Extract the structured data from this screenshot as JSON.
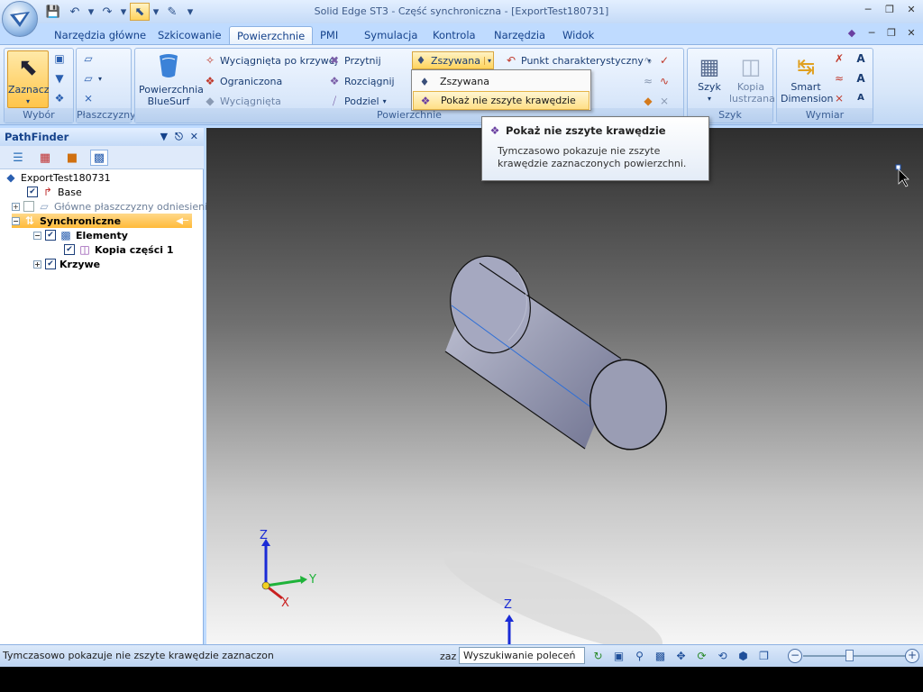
{
  "window": {
    "title": "Solid Edge ST3 - Część synchroniczna - [ExportTest180731]"
  },
  "quick_access": {
    "icons": [
      "save-icon",
      "undo-icon",
      "redo-icon",
      "select-arrow-icon",
      "run-icon"
    ]
  },
  "tabs": [
    {
      "label": "Narzędzia główne",
      "active": false
    },
    {
      "label": "Szkicowanie",
      "active": false
    },
    {
      "label": "Powierzchnie",
      "active": true
    },
    {
      "label": "PMI",
      "active": false
    },
    {
      "label": "Symulacja",
      "active": false
    },
    {
      "label": "Kontrola",
      "active": false
    },
    {
      "label": "Narzędzia",
      "active": false
    },
    {
      "label": "Widok",
      "active": false
    }
  ],
  "ribbon": {
    "wybor": {
      "label": "Wybór",
      "zaznacz": "Zaznacz"
    },
    "plaszczyzny": {
      "label": "Płaszczyzny"
    },
    "powierzchnie": {
      "label": "Powierzchnie",
      "bluesurf": "Powierzchnia BlueSurf",
      "bluesurf_l1": "Powierzchnia",
      "bluesurf_l2": "BlueSurf",
      "wyciagnieta_po_krzywej": "Wyciągnięta po krzywej",
      "ograniczona": "Ograniczona",
      "wyciagnieta": "Wyciągnięta",
      "przytnij": "Przytnij",
      "rozciagnij": "Rozciągnij",
      "podziel": "Podziel",
      "zszywana": "Zszywana",
      "punkt_charakterystyczny": "Punkt charakterystyczny"
    },
    "szyk": {
      "label": "Szyk",
      "szyk": "Szyk",
      "kopia_l1": "Kopia",
      "kopia_l2": "lustrzana"
    },
    "wymiar": {
      "label": "Wymiar",
      "smart_l1": "Smart",
      "smart_l2": "Dimension"
    }
  },
  "dropdown": {
    "items": [
      {
        "label": "Zszywana",
        "highlighted": false
      },
      {
        "label": "Pokaż nie zszyte krawędzie",
        "highlighted": true
      }
    ]
  },
  "tooltip": {
    "title": "Pokaż nie zszyte krawędzie",
    "body": "Tymczasowo pokazuje nie zszyte krawędzie zaznaczonych powierzchni."
  },
  "pathfinder": {
    "title": "PathFinder",
    "tree": [
      {
        "label": "ExportTest180731"
      },
      {
        "label": "Base",
        "checked": true
      },
      {
        "label": "Główne płaszczyzny odniesienia",
        "checked": false
      },
      {
        "label": "Synchroniczne"
      },
      {
        "label": "Elementy",
        "checked": true
      },
      {
        "label": "Kopia części 1",
        "checked": true
      },
      {
        "label": "Krzywe",
        "checked": true
      }
    ]
  },
  "viewport": {
    "axis_main": {
      "z": "Z",
      "y": "Y",
      "x": "X"
    },
    "axis_secondary": {
      "z": "Z"
    },
    "colors": {
      "cylinder": "#9a9db4",
      "edge_highlight": "#2f6fd6"
    }
  },
  "statusbar": {
    "message": "Tymczasowo pokazuje nie zszyte krawędzie zaznaczonych pow",
    "zaz": "zaz",
    "search_value": "Wyszukiwanie poleceń"
  }
}
